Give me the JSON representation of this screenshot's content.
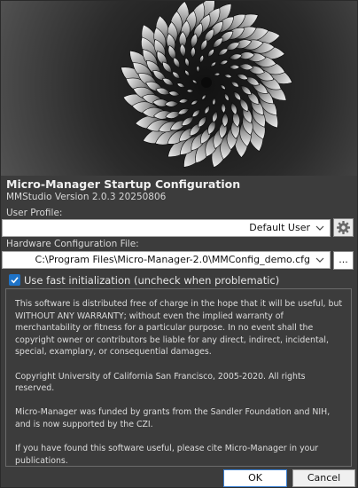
{
  "app": {
    "title": "Micro-Manager Startup Configuration",
    "version": "MMStudio Version 2.0.3 20250806"
  },
  "user_profile": {
    "label": "User Profile:",
    "value": "Default User",
    "settings_icon": "gear-icon"
  },
  "hardware_config": {
    "label": "Hardware Configuration File:",
    "value": "C:\\Program Files\\Micro-Manager-2.0\\MMConfig_demo.cfg",
    "browse_label": "..."
  },
  "fast_init": {
    "checked": true,
    "label": "Use fast initialization (uncheck when problematic)"
  },
  "notice": {
    "paragraphs": [
      "This software is distributed free of charge in the hope that it will be useful, but WITHOUT ANY WARRANTY; without even the implied warranty of merchantability or fitness for a particular purpose. In no event shall the copyright owner or contributors be liable for any direct, indirect, incidental, special, examplary, or consequential damages.",
      "Copyright University of California San Francisco, 2005-2020. All rights reserved.",
      "Micro-Manager was funded by grants from the Sandler Foundation and NIH, and is now supported by the CZI.",
      "If you have found this software useful, please cite Micro-Manager in your publications."
    ]
  },
  "buttons": {
    "ok": "OK",
    "cancel": "Cancel"
  },
  "colors": {
    "background": "#3c3c3c",
    "accent": "#1e73c8"
  }
}
